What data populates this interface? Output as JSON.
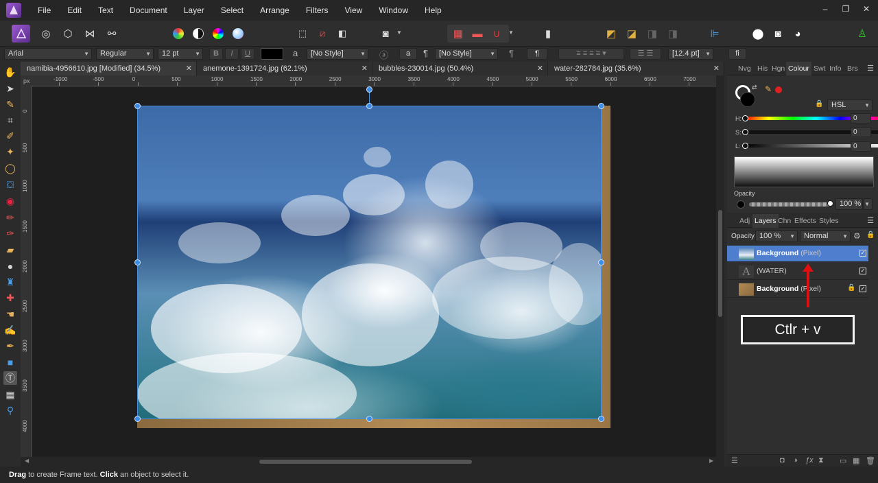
{
  "menubar": {
    "items": [
      "File",
      "Edit",
      "Text",
      "Document",
      "Layer",
      "Select",
      "Arrange",
      "Filters",
      "View",
      "Window",
      "Help"
    ],
    "window_controls": [
      "–",
      "❐",
      "✕"
    ]
  },
  "context_bar": {
    "font_family": "Arial",
    "font_style": "Regular",
    "font_size": "12 pt",
    "char_style": "[No Style]",
    "para_style": "[No Style]",
    "leading": "[12.4 pt]",
    "ligature_label": "fi",
    "bold_label": "B",
    "italic_label": "I",
    "underline_label": "U",
    "text_colour": "#000000"
  },
  "tabs": [
    {
      "label": "namibia-4956610.jpg [Modified] (34.5%)",
      "active": true
    },
    {
      "label": "anemone-1391724.jpg (62.1%)",
      "active": false
    },
    {
      "label": "bubbles-230014.jpg (50.4%)",
      "active": false
    },
    {
      "label": "water-282784.jpg (35.6%)",
      "active": false
    }
  ],
  "tab_close": "✕",
  "ruler": {
    "unit": "px",
    "top_labels": [
      "-1000",
      "-500",
      "0",
      "500",
      "1000",
      "1500",
      "2000",
      "2500",
      "3000",
      "3500",
      "4000",
      "4500",
      "5000",
      "5500",
      "6000",
      "6500",
      "7000"
    ],
    "left_labels": [
      "0",
      "500",
      "1000",
      "1500",
      "2000",
      "2500",
      "3000",
      "3500",
      "4000"
    ]
  },
  "right_panel_tabs": [
    "Nvg",
    "His",
    "Hgn",
    "Colour",
    "Swt",
    "Info",
    "Brs"
  ],
  "panel_menu": "☰",
  "colour": {
    "model": "HSL",
    "h_label": "H:",
    "h_value": "0",
    "s_label": "S:",
    "s_value": "0",
    "l_label": "L:",
    "l_value": "0",
    "opacity_label": "Opacity",
    "opacity_value": "100 %",
    "colours": {
      "fill": "#000000",
      "stroke": "#ffffff",
      "picker_dot": "#e02020"
    }
  },
  "layers_tabs": [
    "Adj",
    "Layers",
    "Chn",
    "Effects",
    "Styles"
  ],
  "layers": {
    "opacity_label": "Opacity:",
    "opacity_value": "100 %",
    "blend_mode": "Normal",
    "rows": [
      {
        "name": "Background",
        "type": "(Pixel)",
        "selected": true,
        "locked": false
      },
      {
        "name": "(WATER)",
        "type": "",
        "selected": false,
        "locked": false
      },
      {
        "name": "Background",
        "type": "(Pixel)",
        "selected": false,
        "locked": true
      }
    ],
    "text_thumb_glyph": "A",
    "check_glyph": "✓"
  },
  "annotation": {
    "label": "Ctlr + v",
    "colour": "#e01010"
  },
  "status": {
    "drag_word": "Drag",
    "drag_text": " to create Frame text. ",
    "click_word": "Click",
    "click_text": " an object to select it."
  }
}
